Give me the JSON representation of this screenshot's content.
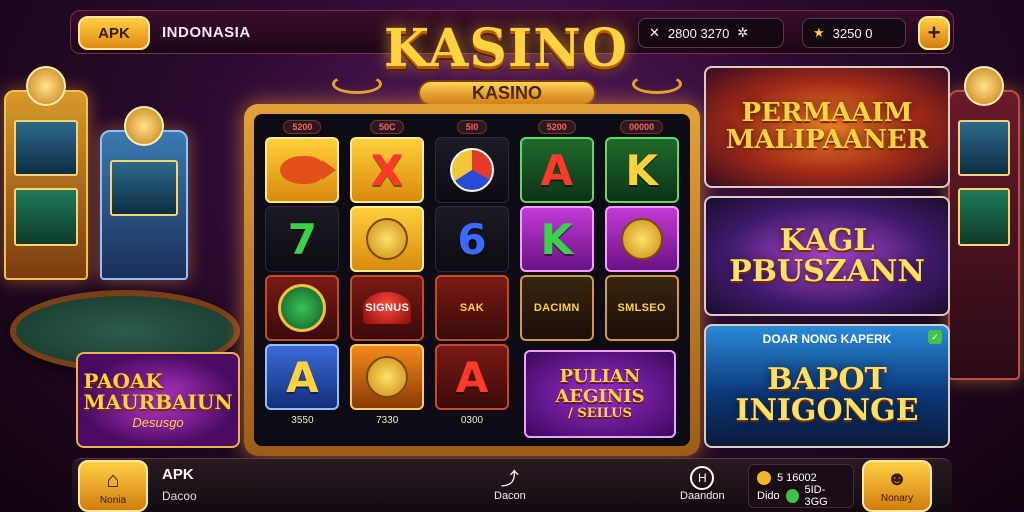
{
  "header": {
    "apk_label": "APK",
    "region": "INDONASIA",
    "stat_a": {
      "icon": "ticket-icon",
      "value": "2800 3270",
      "extra_icon": "settings-icon"
    },
    "stat_b": {
      "icon": "coin-icon",
      "value": "3250 0"
    },
    "plus_label": "+"
  },
  "logo": {
    "title": "KASINO",
    "subtitle": "KASINO"
  },
  "reels": {
    "badges": [
      "5200",
      "50C",
      "5l0",
      "5200",
      "00000"
    ],
    "columns": [
      {
        "symbols": [
          {
            "type": "fish",
            "label": ""
          },
          {
            "type": "letter",
            "label": "7"
          },
          {
            "type": "coin",
            "label": ""
          },
          {
            "type": "letter",
            "label": "A"
          }
        ],
        "value": "3550"
      },
      {
        "symbols": [
          {
            "type": "letter",
            "label": "X"
          },
          {
            "type": "face",
            "label": ""
          },
          {
            "type": "mush",
            "label": "SIGNUS"
          },
          {
            "type": "face",
            "label": ""
          }
        ],
        "value": "7330"
      },
      {
        "symbols": [
          {
            "type": "ball",
            "label": ""
          },
          {
            "type": "letter",
            "label": "6"
          },
          {
            "type": "word",
            "label": "SAK"
          },
          {
            "type": "letter",
            "label": "A"
          }
        ],
        "value": "0300"
      },
      {
        "symbols": [
          {
            "type": "letter",
            "label": "A"
          },
          {
            "type": "letter",
            "label": "K"
          },
          {
            "type": "word",
            "label": "DACIMN"
          },
          {
            "type": "word",
            "label": "PULIAN"
          }
        ],
        "value": ""
      },
      {
        "symbols": [
          {
            "type": "letter",
            "label": "K"
          },
          {
            "type": "face",
            "label": ""
          },
          {
            "type": "word",
            "label": "SMLSEO"
          },
          {
            "type": "word",
            "label": "AEGINIS"
          }
        ],
        "value": ""
      }
    ],
    "bottom_promo": {
      "line1": "PULIAN",
      "line2": "AEGINIS",
      "line3": "/ SEILUS"
    }
  },
  "promos": [
    {
      "top": "",
      "title_lines": [
        "PERMAAIM",
        "MALIPAANER"
      ]
    },
    {
      "top": "",
      "title_lines": [
        "KAGL",
        "PBUSZANN"
      ]
    },
    {
      "top": "DOAR NONG KAPERK",
      "title_lines": [
        "BAPOT",
        "INIGONGE"
      ]
    }
  ],
  "left_promo": {
    "title_lines": [
      "PAOAK",
      "MAURBAIUN"
    ],
    "sub": "Desusgo"
  },
  "footer": {
    "home_label": "Nonia",
    "apk_label": "APK",
    "apk_sub": "Dacoo",
    "mid_label": "Dacon",
    "mid_icon": "share-icon",
    "dd_label": "Daandon",
    "dd_icon": "h-circle-icon",
    "wallet_top": "5 16002",
    "wallet_bottom_a": "Dido",
    "wallet_bottom_b": "5ID-3GG",
    "right_label": "Nonary"
  },
  "colors": {
    "accent_gold": "#ffd23f",
    "background": "#2a0a2e"
  }
}
